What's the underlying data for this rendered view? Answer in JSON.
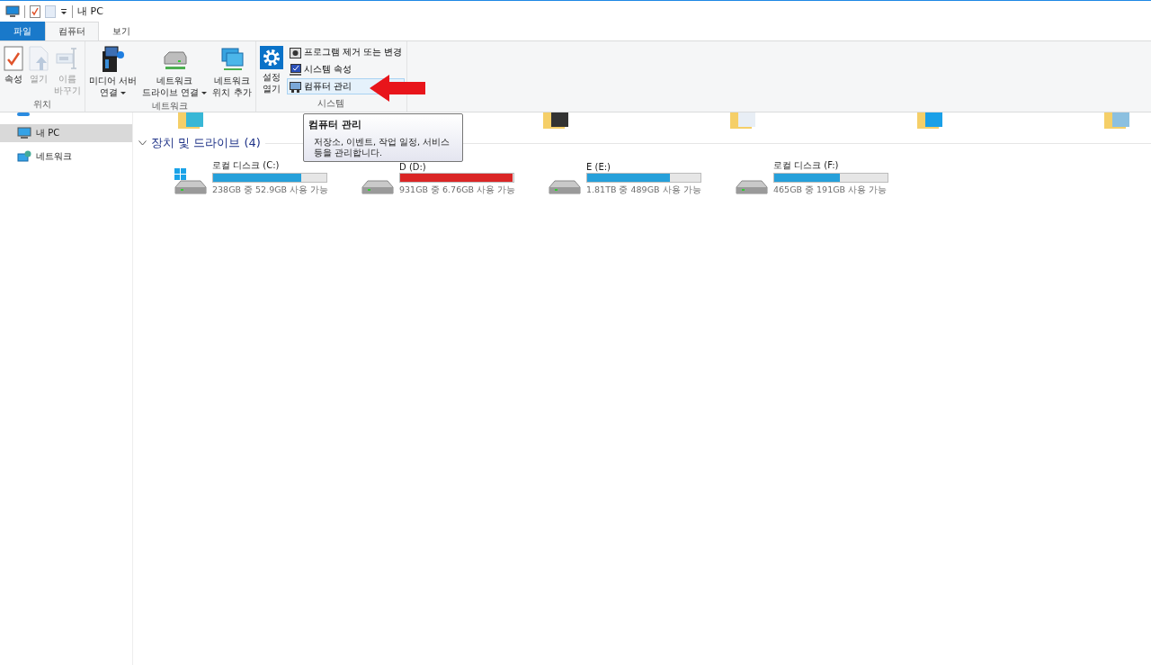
{
  "window": {
    "title": "내 PC"
  },
  "tabs": [
    {
      "label": "파일",
      "kind": "file",
      "selected": false
    },
    {
      "label": "컴퓨터",
      "kind": "tab",
      "selected": true
    },
    {
      "label": "보기",
      "kind": "tab",
      "selected": false
    }
  ],
  "ribbon": {
    "groups": [
      {
        "label": "위치",
        "buttons": [
          {
            "label": "속성",
            "disabled": false
          },
          {
            "label": "열기",
            "disabled": true
          },
          {
            "label": "이름\n바꾸기",
            "disabled": true
          }
        ]
      },
      {
        "label": "네트워크",
        "buttons": [
          {
            "label": "미디어 서버\n연결",
            "disabled": false,
            "dropdown": true
          },
          {
            "label": "네트워크\n드라이브 연결",
            "disabled": false,
            "dropdown": true
          },
          {
            "label": "네트워크\n위치 추가",
            "disabled": false,
            "dropdown": false
          }
        ]
      },
      {
        "label": "시스템",
        "buttons": [
          {
            "label": "설정\n열기",
            "disabled": false
          }
        ],
        "small_buttons": [
          {
            "label": "프로그램 제거 또는 변경",
            "hovered": false
          },
          {
            "label": "시스템 속성",
            "hovered": false
          },
          {
            "label": "컴퓨터 관리",
            "hovered": true
          }
        ]
      }
    ]
  },
  "tooltip": {
    "title": "컴퓨터 관리",
    "text": "저장소, 이벤트, 작업 일정, 서비스\n등을 관리합니다."
  },
  "sidebar": {
    "items": [
      {
        "label": "내 PC",
        "selected": true
      },
      {
        "label": "네트워크",
        "selected": false
      }
    ]
  },
  "section": {
    "title": "장치 및 드라이브 (4)",
    "expanded": true
  },
  "drives": [
    {
      "name": "로컬 디스크 (C:)",
      "kind": "system",
      "level": 0.78,
      "low": false,
      "reading": "238GB 중 52.9GB 사용 가능"
    },
    {
      "name": "D (D:)",
      "kind": "disk",
      "level": 0.99,
      "low": true,
      "reading": "931GB 중 6.76GB 사용 가능"
    },
    {
      "name": "E (E:)",
      "kind": "disk",
      "level": 0.73,
      "low": false,
      "reading": "1.81TB 중 489GB 사용 가능"
    },
    {
      "name": "로컬 디스크 (F:)",
      "kind": "disk",
      "level": 0.58,
      "low": false,
      "reading": "465GB 중 191GB 사용 가능"
    }
  ]
}
